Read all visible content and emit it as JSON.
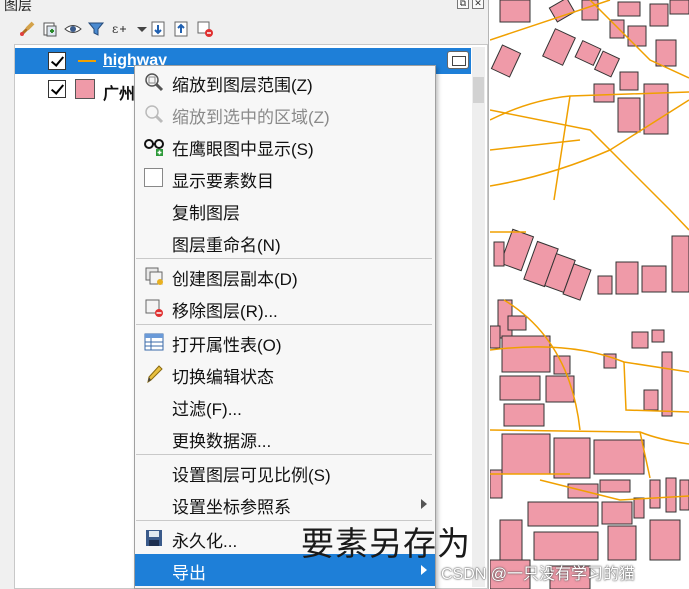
{
  "panel": {
    "title": "图层",
    "window_buttons": [
      "⧉",
      "✕"
    ]
  },
  "toolbar": {
    "icons": [
      "style-brush-icon",
      "add-group-icon",
      "eye-icon",
      "filter-icon",
      "expression-filter-icon",
      "dropdown-icon",
      "expand-all-icon",
      "collapse-all-icon",
      "remove-layer-icon"
    ]
  },
  "layers": [
    {
      "name": "highway",
      "checked": true,
      "selected": true,
      "symbol": "line",
      "color": "#f0a000"
    },
    {
      "name": "广州",
      "checked": true,
      "selected": false,
      "symbol": "polygon",
      "color": "#ef9aa8"
    }
  ],
  "menu": {
    "items": [
      {
        "label": "缩放到图层范围(Z)",
        "icon": "zoom-layer-icon",
        "enabled": true
      },
      {
        "label": "缩放到选中的区域(Z)",
        "icon": "zoom-selection-icon",
        "enabled": false
      },
      {
        "label": "在鹰眼图中显示(S)",
        "icon": "overview-glasses-icon",
        "enabled": true
      },
      {
        "label": "显示要素数目",
        "icon": "checkbox-icon",
        "enabled": true
      },
      {
        "label": "复制图层",
        "icon": "",
        "enabled": true
      },
      {
        "label": "图层重命名(N)",
        "icon": "",
        "enabled": true
      },
      {
        "label": "创建图层副本(D)",
        "icon": "duplicate-layer-icon",
        "enabled": true
      },
      {
        "label": "移除图层(R)...",
        "icon": "remove-layer-icon",
        "enabled": true
      },
      {
        "label": "打开属性表(O)",
        "icon": "attribute-table-icon",
        "enabled": true
      },
      {
        "label": "切换编辑状态",
        "icon": "pencil-icon",
        "enabled": true
      },
      {
        "label": "过滤(F)...",
        "icon": "",
        "enabled": true
      },
      {
        "label": "更换数据源...",
        "icon": "",
        "enabled": true
      },
      {
        "label": "设置图层可见比例(S)",
        "icon": "",
        "enabled": true
      },
      {
        "label": "设置坐标参照系",
        "icon": "",
        "enabled": true,
        "submenu": true
      },
      {
        "label": "永久化...",
        "icon": "save-disk-icon",
        "enabled": true
      },
      {
        "label": "导出",
        "icon": "",
        "enabled": true,
        "submenu": true,
        "highlighted": true
      }
    ]
  },
  "caption": "要素另存为",
  "watermark": "CSDN @一只没有学习的猫",
  "colors": {
    "selection": "#1e7fd8",
    "road": "#f0a000",
    "building_fill": "#ef9aa8",
    "building_stroke": "#333333"
  }
}
